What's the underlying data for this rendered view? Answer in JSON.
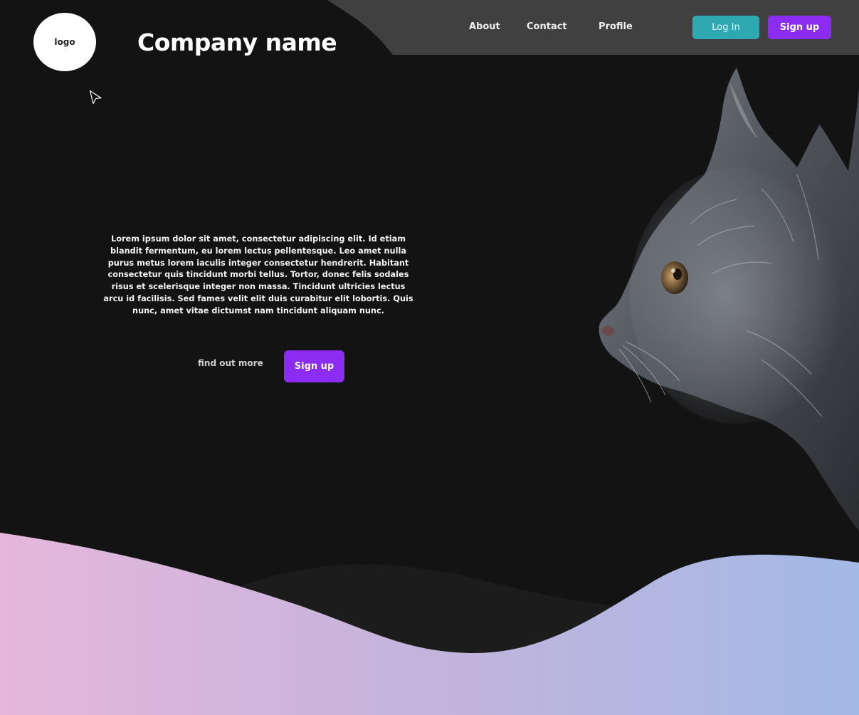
{
  "header": {
    "logo_text": "logo",
    "company_name": "Company name",
    "nav": [
      {
        "label": "About"
      },
      {
        "label": "Contact"
      },
      {
        "label": "Profile"
      }
    ],
    "login_label": "Log In",
    "signup_label": "Sign up"
  },
  "hero": {
    "body": "Lorem ipsum dolor sit amet, consectetur adipiscing elit. Id etiam blandit fermentum, eu lorem lectus pellentesque. Leo amet nulla purus metus lorem iaculis integer consectetur hendrerit. Habitant consectetur quis tincidunt morbi tellus. Tortor, donec felis sodales risus et scelerisque integer non massa. Tincidunt ultricies lectus arcu id facilisis. Sed fames velit elit duis curabitur elit lobortis. Quis nunc, amet vitae dictumst nam tincidunt aliquam nunc.",
    "find_more_label": "find out more",
    "signup_label": "Sign up"
  },
  "colors": {
    "background": "#131314",
    "topbar": "#404040",
    "login": "#2ea9b2",
    "signup": "#8c2cf2",
    "wave_pink": "#e8b8de",
    "wave_blue": "#a3b9e6"
  },
  "icons": {
    "cursor": "mouse-pointer-icon",
    "hero_image": "cat-photo"
  }
}
